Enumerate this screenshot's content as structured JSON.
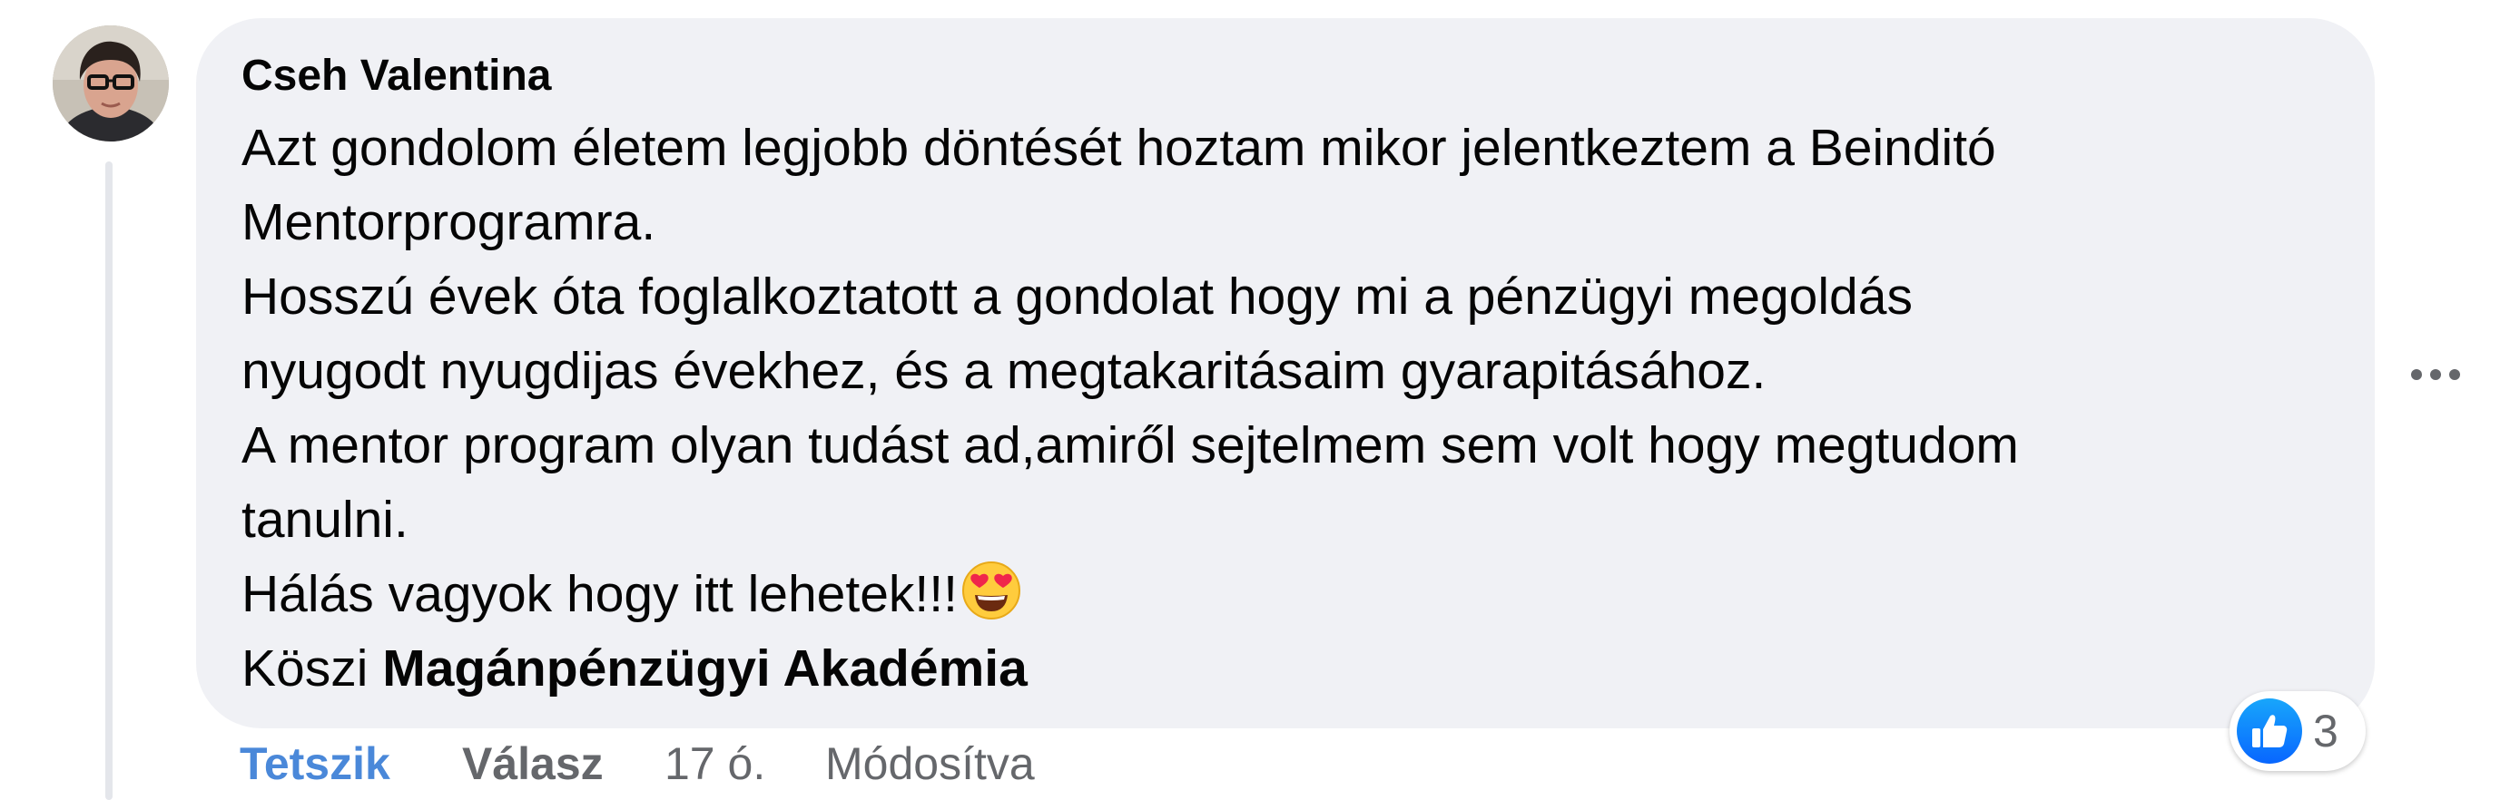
{
  "comment": {
    "author": "Cseh Valentina",
    "lines": [
      "Azt gondolom életem legjobb döntését hoztam mikor jelentkeztem a Beinditó",
      "Mentorprogramra.",
      "Hosszú évek óta foglalkoztatott a gondolat hogy mi a pénzügyi megoldás",
      "nyugodt nyugdijas évekhez, és a megtakaritásaim gyarapitásához.",
      "A mentor program olyan tudást ad,amiről sejtelmem sem volt hogy megtudom",
      "tanulni.",
      "Hálás vagyok hogy itt lehetek!!!"
    ],
    "emoji": "heart-eyes-emoji",
    "closing_prefix": "Köszi ",
    "mention": "Magánpénzügyi Akadémia"
  },
  "reactions": {
    "icon": "thumbs-up-icon",
    "count": "3",
    "accent": "#0866ff"
  },
  "actions": {
    "like": "Tetszik",
    "reply": "Válasz",
    "time": "17 ó.",
    "edited": "Módosítva"
  },
  "colors": {
    "bubble": "#f0f1f5",
    "secondary_text": "#65676b",
    "like_link": "#4a88d9"
  }
}
